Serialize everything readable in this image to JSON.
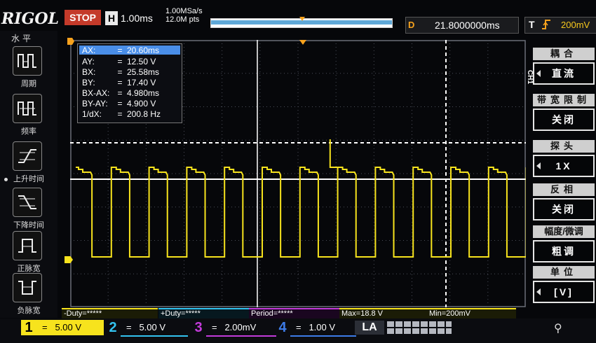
{
  "brand": "RIGOL",
  "status": "STOP",
  "horizontal": {
    "badge": "H",
    "timebase": "1.00ms",
    "sample_rate": "1.00MSa/s",
    "memory_depth": "12.0M pts"
  },
  "delay": {
    "label": "D",
    "value": "21.8000000ms"
  },
  "trigger": {
    "label": "T",
    "icon": "rising-edge-icon",
    "level": "200mV"
  },
  "left_menu": {
    "title": "水平",
    "items": [
      {
        "label": "周期",
        "icon": "period-icon"
      },
      {
        "label": "频率",
        "icon": "frequency-icon"
      },
      {
        "label": "上升时间",
        "icon": "rise-time-icon"
      },
      {
        "label": "下降时间",
        "icon": "fall-time-icon"
      },
      {
        "label": "正脉宽",
        "icon": "positive-width-icon"
      },
      {
        "label": "负脉宽",
        "icon": "negative-width-icon"
      }
    ]
  },
  "cursor": {
    "rows": [
      {
        "key": "AX:",
        "value": "20.60ms"
      },
      {
        "key": "AY:",
        "value": "12.50 V"
      },
      {
        "key": "BX:",
        "value": "25.58ms"
      },
      {
        "key": "BY:",
        "value": "17.40 V"
      },
      {
        "key": "BX-AX:",
        "value": "4.980ms"
      },
      {
        "key": "BY-AY:",
        "value": "4.900 V"
      },
      {
        "key": "1/dX:",
        "value": "200.8 Hz"
      }
    ]
  },
  "right_menu": {
    "channel": "CH1",
    "items": [
      {
        "title": "耦合",
        "value": "直流",
        "arrow": true
      },
      {
        "title": "带宽限制",
        "value": "关闭",
        "arrow": false
      },
      {
        "title": "探头",
        "value": "1X",
        "arrow": true
      },
      {
        "title": "反相",
        "value": "关闭",
        "arrow": false
      },
      {
        "title": "幅度/微调",
        "value": "粗调",
        "arrow": false
      },
      {
        "title": "单位",
        "value": "[V]",
        "arrow": true
      }
    ]
  },
  "measurements": [
    {
      "label": "-Duty=*****",
      "color": "#f7e31d"
    },
    {
      "label": "+Duty=*****",
      "color": "#33c3f0"
    },
    {
      "label": "Period=*****",
      "color": "#c23bd9"
    },
    {
      "label": "Max=18.8 V",
      "color": "#f7e31d"
    },
    {
      "label": "Min=200mV",
      "color": "#f7e31d"
    }
  ],
  "channels": [
    {
      "num": "1",
      "eq": "=",
      "scale": "5.00 V",
      "color": "#f7e31d",
      "active": true
    },
    {
      "num": "2",
      "eq": "=",
      "scale": "5.00 V",
      "color": "#33c3f0",
      "active": false
    },
    {
      "num": "3",
      "eq": "=",
      "scale": "2.00mV",
      "color": "#c23bd9",
      "active": false
    },
    {
      "num": "4",
      "eq": "=",
      "scale": "1.00 V",
      "color": "#3d7ce8",
      "active": false
    }
  ],
  "la_label": "LA",
  "colors": {
    "ch1": "#f7e31d",
    "cursor": "#ffffff",
    "trigger": "#f7a21d",
    "accent": "#4a8ee8"
  },
  "waveform": {
    "description_units": "divisions",
    "period_div": 1.0,
    "high_level_div": 4.6,
    "low_level_div": 1.9,
    "duty_high": 0.43,
    "first_rise_div": 0.05,
    "cycles": 12
  }
}
